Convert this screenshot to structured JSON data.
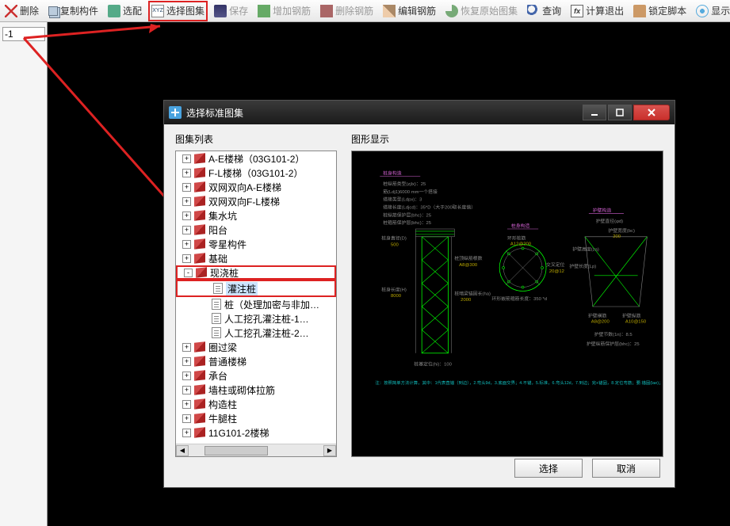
{
  "toolbar": {
    "items": [
      {
        "id": "delete",
        "label": "删除",
        "icon": "ic-del"
      },
      {
        "id": "copy-member",
        "label": "复制构件",
        "icon": "ic-copy"
      },
      {
        "id": "select-match",
        "label": "选配",
        "icon": "ic-sel"
      },
      {
        "id": "select-atlas",
        "label": "选择图集",
        "icon": "ic-xyz",
        "highlight": true
      },
      {
        "id": "save",
        "label": "保存",
        "icon": "ic-save",
        "disabled": true
      },
      {
        "id": "add-rebar",
        "label": "增加钢筋",
        "icon": "ic-add",
        "disabled": true
      },
      {
        "id": "del-rebar",
        "label": "删除钢筋",
        "icon": "ic-minus",
        "disabled": true
      },
      {
        "id": "edit-rebar",
        "label": "编辑钢筋",
        "icon": "ic-edit"
      },
      {
        "id": "restore",
        "label": "恢复原始图集",
        "icon": "ic-restore",
        "disabled": true
      },
      {
        "id": "query",
        "label": "查询",
        "icon": "ic-find"
      },
      {
        "id": "calc-exit",
        "label": "计算退出",
        "icon": "ic-calc"
      },
      {
        "id": "lock-script",
        "label": "锁定脚本",
        "icon": "ic-lock"
      },
      {
        "id": "fit-view",
        "label": "显示全图",
        "icon": "ic-fit"
      }
    ]
  },
  "left_input": "-1",
  "dialog": {
    "title": "选择标准图集",
    "tree_label": "图集列表",
    "preview_label": "图形显示",
    "select_btn": "选择",
    "cancel_btn": "取消",
    "tree": [
      {
        "label": "A-E楼梯（03G101-2）",
        "icon": "book",
        "lvl": 1,
        "exp": "+"
      },
      {
        "label": "F-L楼梯（03G101-2）",
        "icon": "book",
        "lvl": 1,
        "exp": "+"
      },
      {
        "label": "双网双向A-E楼梯",
        "icon": "book",
        "lvl": 1,
        "exp": "+"
      },
      {
        "label": "双网双向F-L楼梯",
        "icon": "book",
        "lvl": 1,
        "exp": "+"
      },
      {
        "label": "集水坑",
        "icon": "book",
        "lvl": 1,
        "exp": "+"
      },
      {
        "label": "阳台",
        "icon": "book",
        "lvl": 1,
        "exp": "+"
      },
      {
        "label": "零星构件",
        "icon": "book",
        "lvl": 1,
        "exp": "+"
      },
      {
        "label": "基础",
        "icon": "book",
        "lvl": 1,
        "exp": "+"
      },
      {
        "label": "现浇桩",
        "icon": "book",
        "lvl": 1,
        "exp": "-",
        "parent": true
      },
      {
        "label": "灌注桩",
        "icon": "page",
        "lvl": 2,
        "sel": true
      },
      {
        "label": "桩（处理加密与非加…",
        "icon": "page",
        "lvl": 2
      },
      {
        "label": "人工挖孔灌注桩-1…",
        "icon": "page",
        "lvl": 2
      },
      {
        "label": "人工挖孔灌注桩-2…",
        "icon": "page",
        "lvl": 2
      },
      {
        "label": "圈过梁",
        "icon": "book",
        "lvl": 1,
        "exp": "+"
      },
      {
        "label": "普通楼梯",
        "icon": "book",
        "lvl": 1,
        "exp": "+"
      },
      {
        "label": "承台",
        "icon": "book",
        "lvl": 1,
        "exp": "+"
      },
      {
        "label": "墙柱或砌体拉筋",
        "icon": "book",
        "lvl": 1,
        "exp": "+"
      },
      {
        "label": "构造柱",
        "icon": "book",
        "lvl": 1,
        "exp": "+"
      },
      {
        "label": "牛腿柱",
        "icon": "book",
        "lvl": 1,
        "exp": "+"
      },
      {
        "label": "11G101-2楼梯",
        "icon": "book",
        "lvl": 1,
        "exp": "+"
      }
    ]
  },
  "preview": {
    "section1_title": "桩身构造",
    "p1a": "桩纵筋类型(zjlx)：25",
    "p1b": "筋(Ldj1)6000 mm一个搭接",
    "p1c": "搭接类型(Ldpx)：3",
    "p1d": "搭接长度(Ldjcd)：35*D（大于200取长度值）",
    "p1e": "桩纵筋保护层(bhc)：25",
    "p1f": "桩箍筋保护层(bhc)：25",
    "left_dim1": "桩身直径(D)",
    "left_dim1v": "500",
    "left_dim2": "桩身长度(H)",
    "left_dim2v": "8000",
    "mid_lbl1": "桩顶纵筋根数",
    "mid_lbl1v": "A8@300",
    "mid_lbl2": "桩暗梁锚固长(ha)",
    "mid_lbl2v": "2000",
    "bottom_lbl": "桩基定位(hi)：100",
    "section2_title": "桩身构造",
    "ring_top": "环形桩筋",
    "ring_top_v": "A12@200",
    "ring_bot": "环形嵌筋箍筋长度：350 *d",
    "ring_mid": "交叉定位",
    "ring_mid_v": "20@12",
    "section3_title": "护壁构造",
    "s3a": "护壁直径(φd)",
    "s3b": "护壁宽度(bc)",
    "s3b_v": "200",
    "s3c": "护壁长度(Lp)",
    "s3d": "护壁高度(za)",
    "s4a": "护壁横筋",
    "s4a_v": "A8@200",
    "s4b": "护壁纵筋",
    "s4b_v": "A10@150",
    "s4c": "护壁节数(1n)：8.5",
    "s4d": "护壁纵筋保护层(bhc)：25",
    "note": "注：按照简单方法计算，其中：1代表直锚（到边），2.弯头9d，3.底面交界；4.不锚，5.标准，6.弯头12d，7.到边；完+锚固，8.定位弯筋；要.锚固(lae)；"
  }
}
